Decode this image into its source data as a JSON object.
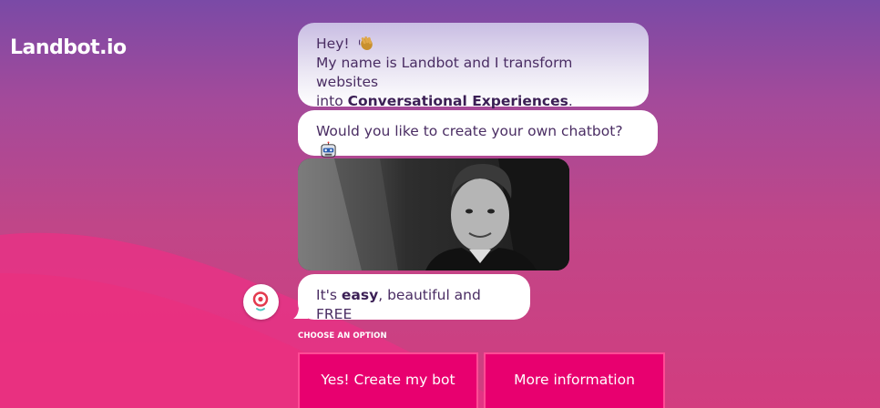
{
  "brand": {
    "logo_text": "Landbot.io"
  },
  "chat": {
    "message1": {
      "line1": "Hey!",
      "wave_emoji": "waving-hand-icon",
      "line2": "My name is Landbot and I transform websites",
      "line3_prefix": "into ",
      "line3_bold": "Conversational Experiences",
      "line3_suffix": "."
    },
    "message2": {
      "text": "Would you like to create your own chatbot?",
      "emoji": "robot-face-icon"
    },
    "gif": {
      "description_icon": "animated-gif-image"
    },
    "message3": {
      "prefix": "It's ",
      "bold": "easy",
      "suffix": ", beautiful and FREE"
    },
    "bot_avatar": "landbot-avatar-icon"
  },
  "options": {
    "heading": "CHOOSE AN OPTION",
    "buttons": [
      {
        "label": "Yes! Create my bot"
      },
      {
        "label": "More information"
      }
    ]
  },
  "colors": {
    "bubble_text": "#4a2d63",
    "button_bg": "#e8006f",
    "button_border": "#ff4b95",
    "background_top": "#7a4aa6",
    "background_bottom": "#d23d7f"
  }
}
